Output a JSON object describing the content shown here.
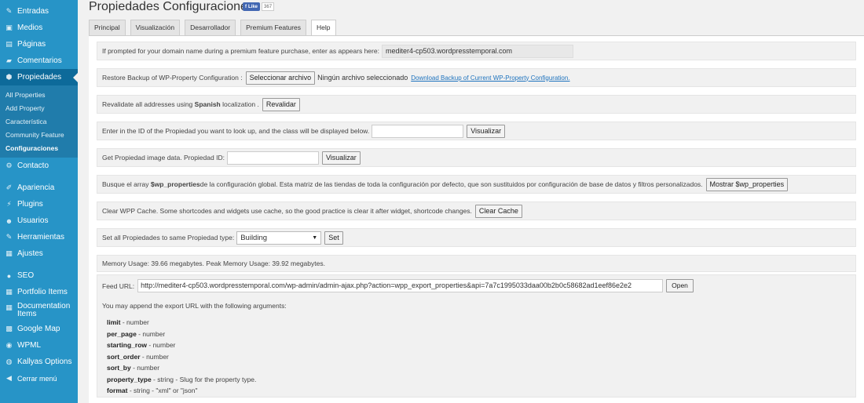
{
  "sidebar": {
    "items_top": [
      {
        "label": "Entradas",
        "icon": "pin-icon"
      },
      {
        "label": "Medios",
        "icon": "media-icon"
      },
      {
        "label": "Páginas",
        "icon": "pages-icon"
      },
      {
        "label": "Comentarios",
        "icon": "comments-icon"
      }
    ],
    "active": {
      "label": "Propiedades",
      "icon": "property-icon"
    },
    "submenu": [
      "All Properties",
      "Add Property",
      "Característica",
      "Community Feature",
      "Configuraciones"
    ],
    "submenu_current": "Configuraciones",
    "items_mid": [
      {
        "label": "Contacto",
        "icon": "contact-icon"
      }
    ],
    "items_admin": [
      {
        "label": "Apariencia",
        "icon": "brush-icon"
      },
      {
        "label": "Plugins",
        "icon": "plugin-icon"
      },
      {
        "label": "Usuarios",
        "icon": "users-icon"
      },
      {
        "label": "Herramientas",
        "icon": "wrench-icon"
      },
      {
        "label": "Ajustes",
        "icon": "settings-icon"
      }
    ],
    "items_extra": [
      {
        "label": "SEO",
        "icon": "seo-icon"
      },
      {
        "label": "Portfolio Items",
        "icon": "grid-icon"
      },
      {
        "label": "Documentation Items",
        "icon": "grid-icon"
      },
      {
        "label": "Google Map",
        "icon": "map-icon"
      },
      {
        "label": "WPML",
        "icon": "globe-icon"
      },
      {
        "label": "Kallyas Options",
        "icon": "options-icon"
      },
      {
        "label": "Cerrar menú",
        "icon": "collapse-icon"
      }
    ]
  },
  "header": {
    "title": "Propiedades Configuraciones",
    "fb_like": "Like",
    "fb_count": "367"
  },
  "tabs": [
    "Principal",
    "Visualización",
    "Desarrollador",
    "Premium Features",
    "Help"
  ],
  "active_tab": "Help",
  "rows": {
    "domain_label": "If prompted for your domain name during a premium feature purchase, enter as appears here:",
    "domain_value": "mediter4-cp503.wordpresstemporal.com",
    "restore_label": "Restore Backup of WP-Property Configuration :",
    "restore_button": "Seleccionar archivo",
    "restore_status": "Ningún archivo seleccionado",
    "restore_link": "Download Backup of Current WP-Property Configuration.",
    "revalidate_pre": "Revalidate all addresses using",
    "revalidate_lang": "Spanish",
    "revalidate_post": "localization .",
    "revalidate_button": "Revalidar",
    "lookup_label": "Enter in the ID of the Propiedad you want to look up, and the class will be displayed below.",
    "lookup_button": "Visualizar",
    "image_label": "Get Propiedad image data.",
    "image_id_label": "Propiedad ID:",
    "image_button": "Visualizar",
    "array_pre": "Busque el array",
    "array_var": "$wp_properties",
    "array_post": "de la configuración global. Esta matriz de las tiendas de toda la configuración por defecto, que son sustituidos por configuración de base de datos y filtros personalizados.",
    "array_button": "Mostrar $wp_properties",
    "cache_label": "Clear WPP Cache. Some shortcodes and widgets use cache, so the good practice is clear it after widget, shortcode changes.",
    "cache_button": "Clear Cache",
    "type_label": "Set all Propiedades to same Propiedad type:",
    "type_selected": "Building",
    "type_button": "Set",
    "memory_text": "Memory Usage: 39.66 megabytes. Peak Memory Usage: 39.92 megabytes."
  },
  "feed": {
    "label": "Feed URL:",
    "url": "http://mediter4-cp503.wordpresstemporal.com/wp-admin/admin-ajax.php?action=wpp_export_properties&api=7a7c1995033daa00b2b0c58682ad1eef86e2e2",
    "open_button": "Open",
    "note": "You may append the export URL with the following arguments:",
    "args": [
      {
        "name": "limit",
        "desc": " - number"
      },
      {
        "name": "per_page",
        "desc": " - number"
      },
      {
        "name": "starting_row",
        "desc": " - number"
      },
      {
        "name": "sort_order",
        "desc": " - number"
      },
      {
        "name": "sort_by",
        "desc": " - number"
      },
      {
        "name": "property_type",
        "desc": " - string - Slug for the property type."
      },
      {
        "name": "format",
        "desc": " - string - \"xml\" or \"json\""
      }
    ]
  }
}
